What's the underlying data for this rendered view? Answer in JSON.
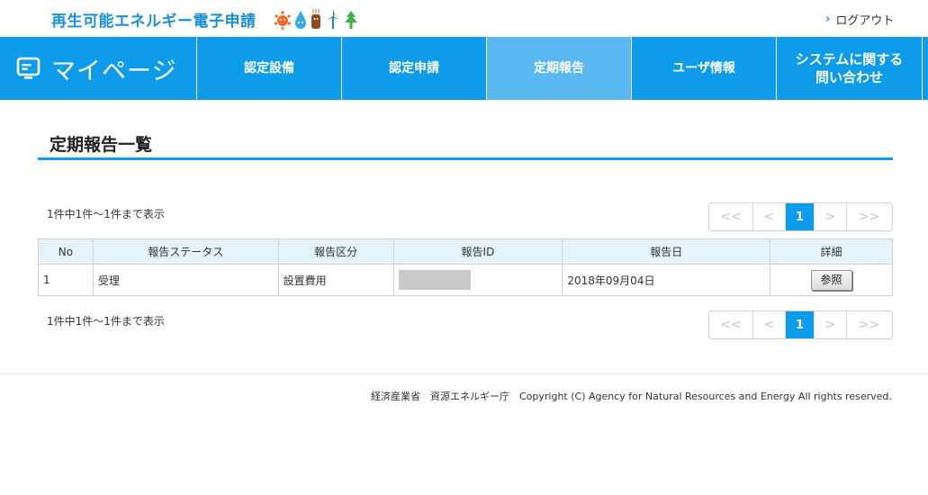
{
  "header": {
    "site_title": "再生可能エネルギー電子申請",
    "logout_label": "ログアウト"
  },
  "nav": {
    "mypage_label": "マイページ",
    "items": [
      {
        "label": "認定設備"
      },
      {
        "label": "認定申請"
      },
      {
        "label": "定期報告"
      },
      {
        "label": "ユーザ情報"
      },
      {
        "label": "システムに関する\n問い合わせ"
      }
    ]
  },
  "page": {
    "title": "定期報告一覧",
    "count_text_top": "1件中1件～1件まで表示",
    "count_text_bottom": "1件中1件～1件まで表示"
  },
  "pagination": {
    "first": "<<",
    "prev": "<",
    "current": "1",
    "next": ">",
    "last": ">>"
  },
  "table": {
    "headers": [
      "No",
      "報告ステータス",
      "報告区分",
      "報告ID",
      "報告日",
      "詳細"
    ],
    "rows": [
      {
        "no": "1",
        "status": "受理",
        "category": "設置費用",
        "report_id": "",
        "date": "2018年09月04日",
        "detail_label": "参照"
      }
    ]
  },
  "footer": {
    "text": "経済産業省　資源エネルギー庁　Copyright (C) Agency for Natural Resources and Energy All rights reserved."
  },
  "colors": {
    "brand_blue": "#0d9bea",
    "active_tab": "#5ab8f0",
    "table_header": "#e4f3fc"
  },
  "icons": {
    "mypage": "monitor-icon",
    "logout": "chevron-right-icon"
  }
}
